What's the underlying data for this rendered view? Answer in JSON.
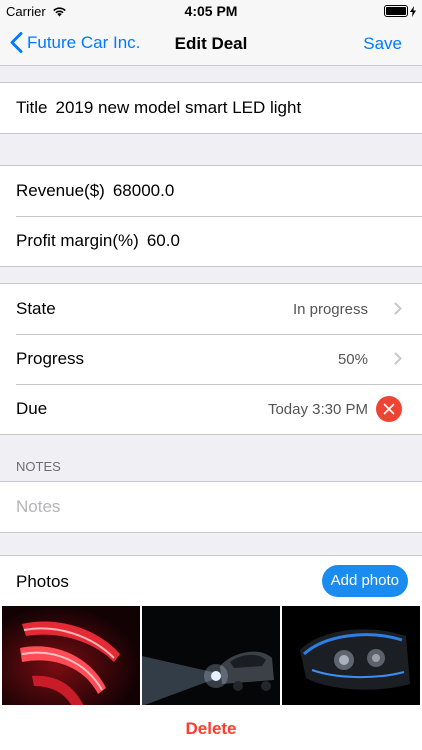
{
  "status_bar": {
    "carrier": "Carrier",
    "time": "4:05 PM"
  },
  "nav": {
    "back_label": "Future Car Inc.",
    "title": "Edit Deal",
    "save_label": "Save"
  },
  "title_row": {
    "label": "Title",
    "value": "2019 new model smart LED light"
  },
  "financials": {
    "revenue_label": "Revenue($)",
    "revenue_value": "68000.0",
    "margin_label": "Profit margin(%)",
    "margin_value": "60.0"
  },
  "details": {
    "state_label": "State",
    "state_value": "In progress",
    "progress_label": "Progress",
    "progress_value": "50%",
    "due_label": "Due",
    "due_value": "Today 3:30 PM"
  },
  "notes": {
    "header": "NOTES",
    "placeholder": "Notes"
  },
  "photos": {
    "label": "Photos",
    "add_label": "Add photo"
  },
  "delete_label": "Delete",
  "colors": {
    "accent": "#007aff",
    "add_button": "#1a8cf0",
    "destructive": "#ff3b30",
    "clear": "#ee4433"
  }
}
